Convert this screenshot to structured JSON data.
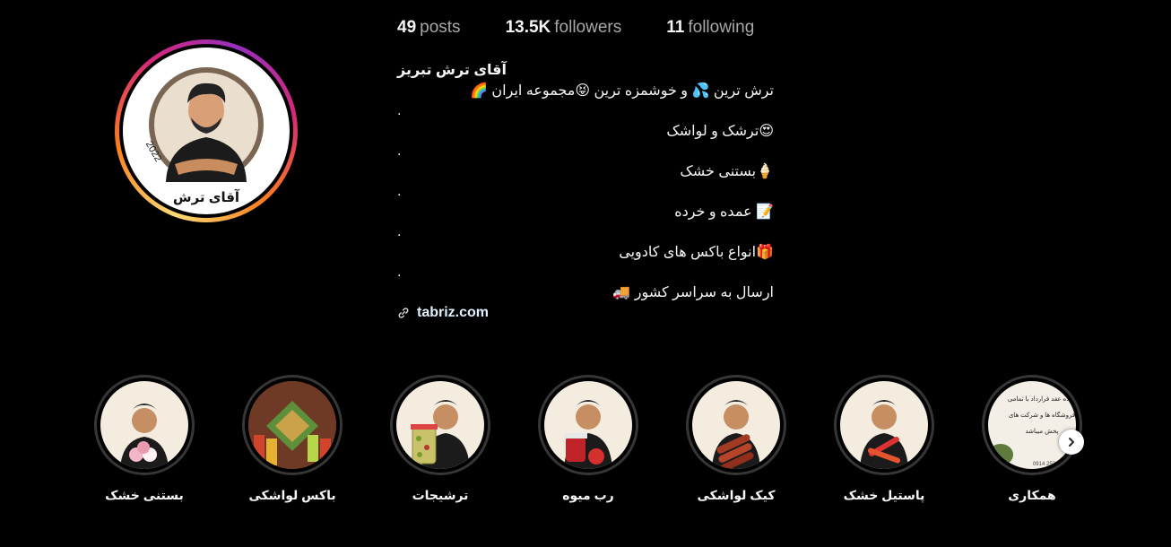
{
  "profile": {
    "avatar_badge_text": "آقای ترش",
    "avatar_year": "2022",
    "stats": [
      {
        "value": "49",
        "label": "posts"
      },
      {
        "value": "13.5K",
        "label": "followers"
      },
      {
        "value": "11",
        "label": "following"
      }
    ],
    "name": "آقای ترش تبریز",
    "bio_lines": [
      "ترش ترین 💦 و خوشمزه ترین 😝مجموعه ایران 🌈",
      ".",
      "😍ترشک و لواشک",
      ".",
      "🍦بستنی خشک",
      ".",
      "📝 عمده و خرده",
      ".",
      "🎁انواع باکس های کادویی",
      ".",
      "ارسال به سراسر کشور 🚚"
    ],
    "link": "tabriz.com"
  },
  "highlights": [
    {
      "label": "بستنی خشک",
      "icon": "ice-cream"
    },
    {
      "label": "باکس لواشکی",
      "icon": "candy-box"
    },
    {
      "label": "ترشیجات",
      "icon": "pickle-jar"
    },
    {
      "label": "رب میوه",
      "icon": "tomato-paste"
    },
    {
      "label": "کیک لواشکی",
      "icon": "fruit-roll"
    },
    {
      "label": "پاستیل خشک",
      "icon": "gummy"
    },
    {
      "label": "همکاری",
      "icon": "text-card"
    }
  ],
  "highlight_card_text": [
    "آماده عقد قرارداد با تمامی",
    "فروشگاه ها و شرکت های",
    "پخش میباشد",
    "0914 252 0990"
  ],
  "colors": {
    "background": "#000000",
    "text": "#f5f5f5",
    "muted": "#a8a8a8",
    "ring": "#363636"
  }
}
